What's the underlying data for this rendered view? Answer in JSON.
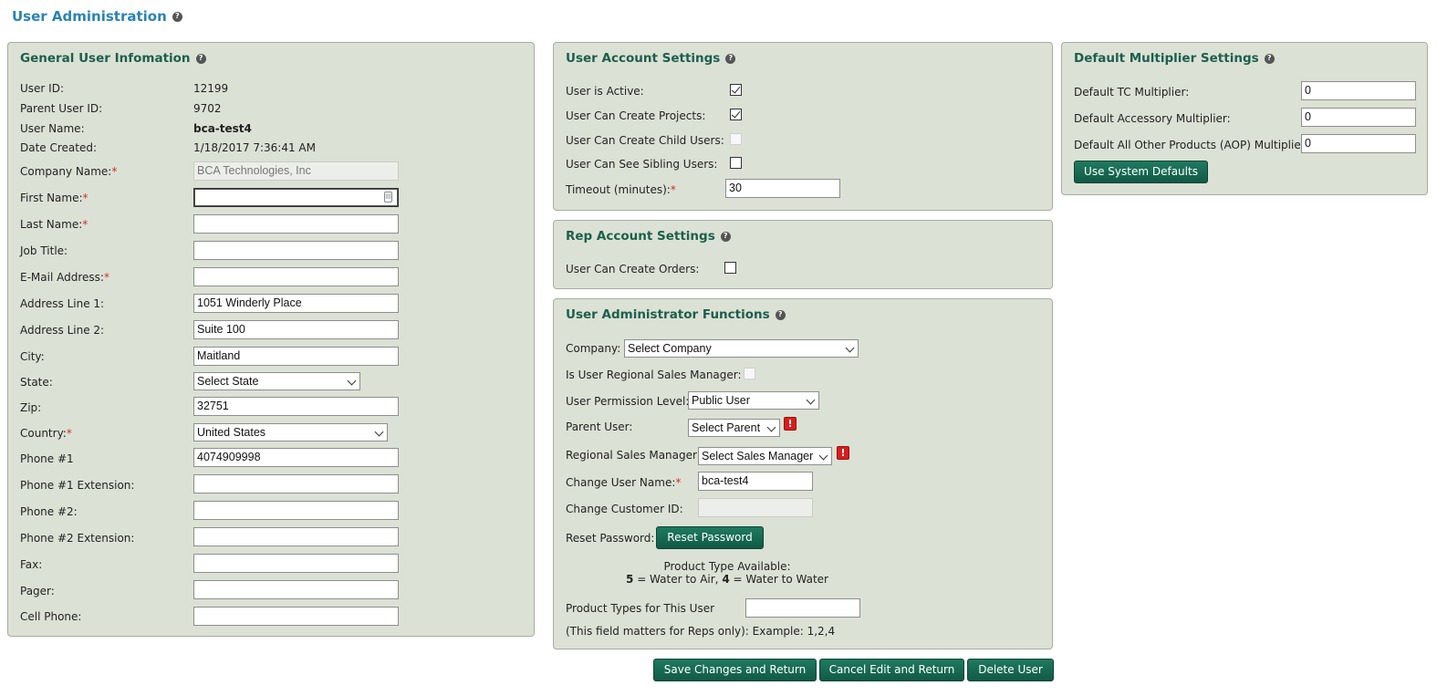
{
  "page": {
    "title": "User Administration"
  },
  "general": {
    "title": "General User Infomation",
    "user_id_label": "User ID:",
    "user_id": "12199",
    "parent_id_label": "Parent User ID:",
    "parent_id": "9702",
    "username_label": "User Name:",
    "username": "bca-test4",
    "date_label": "Date Created:",
    "date_created": "1/18/2017 7:36:41 AM",
    "company_label": "Company Name:",
    "company": "BCA Technologies, Inc",
    "first_label": "First Name:",
    "first_name": "",
    "last_label": "Last Name:",
    "last_name": "",
    "job_label": "Job Title:",
    "job_title": "",
    "email_label": "E-Mail Address:",
    "email": "",
    "addr1_label": "Address Line 1:",
    "addr1": "1051 Winderly Place",
    "addr2_label": "Address Line 2:",
    "addr2": "Suite 100",
    "city_label": "City:",
    "city": "Maitland",
    "state_label": "State:",
    "state": "Select State",
    "zip_label": "Zip:",
    "zip": "32751",
    "country_label": "Country:",
    "country": "United States",
    "phone1_label": "Phone #1",
    "phone1": "4074909998",
    "phone1ext_label": "Phone #1 Extension:",
    "phone1ext": "",
    "phone2_label": "Phone #2:",
    "phone2": "",
    "phone2ext_label": "Phone #2 Extension:",
    "phone2ext": "",
    "fax_label": "Fax:",
    "fax": "",
    "pager_label": "Pager:",
    "pager": "",
    "cell_label": "Cell Phone:",
    "cell": "",
    "required_mark": "*"
  },
  "account": {
    "title": "User Account Settings",
    "active_label": "User is Active:",
    "active": true,
    "projects_label": "User Can Create Projects:",
    "projects": true,
    "child_label": "User Can Create Child Users:",
    "child": false,
    "sibling_label": "User Can See Sibling Users:",
    "sibling": false,
    "timeout_label": "Timeout (minutes):",
    "timeout": "30"
  },
  "rep": {
    "title": "Rep Account Settings",
    "orders_label": "User Can Create Orders:",
    "orders": false
  },
  "admin": {
    "title": "User Administrator Functions",
    "company_label": "Company:",
    "company": "Select Company",
    "rsm_label": "Is User Regional Sales Manager:",
    "perm_label": "User Permission Level:",
    "perm": "Public User",
    "parent_label": "Parent User:",
    "parent": "Select Parent",
    "sales_mgr_label": "Regional Sales Manager:",
    "sales_mgr": "Select Sales Manager",
    "change_name_label": "Change User Name:",
    "change_name": "bca-test4",
    "cust_id_label": "Change Customer ID:",
    "cust_id": "",
    "reset_label": "Reset Password:",
    "reset_button": "Reset Password",
    "product_avail_title": "Product Type Available:",
    "product_code_5": "5",
    "product_desc_5": " = Water to Air, ",
    "product_code_4": "4",
    "product_desc_4": " = Water to Water",
    "product_types_label": "Product Types for This User",
    "product_types": "",
    "product_note": "(This field matters for Reps only): Example: 1,2,4",
    "warn_symbol": "!"
  },
  "multiplier": {
    "title": "Default Multiplier Settings",
    "tc_label": "Default TC Multiplier:",
    "tc": "0",
    "acc_label": "Default Accessory Multiplier:",
    "acc": "0",
    "aop_label": "Default All Other Products (AOP) Multiplier:",
    "aop": "0",
    "defaults_button": "Use System Defaults"
  },
  "footer": {
    "save": "Save Changes and Return",
    "cancel": "Cancel Edit and Return",
    "delete": "Delete User"
  },
  "icons": {
    "help": "?",
    "contact_card": "▤"
  }
}
